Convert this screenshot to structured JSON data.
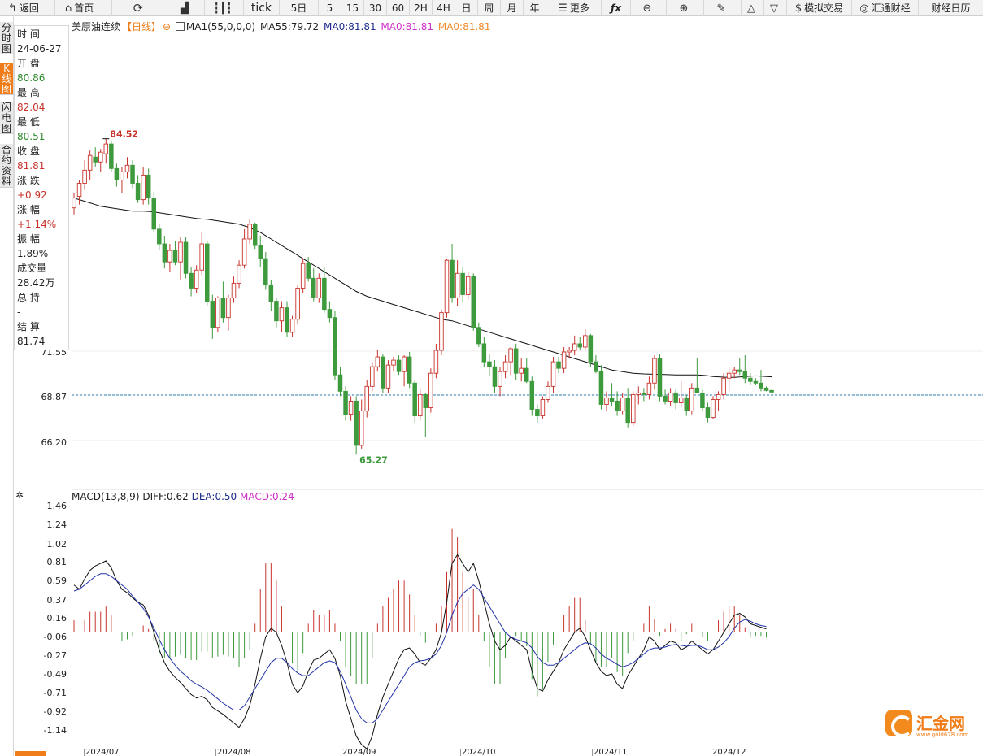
{
  "toolbar": {
    "back": "返回",
    "home": "首页",
    "tick": "tick",
    "periods": [
      "5日",
      "5",
      "15",
      "30",
      "60",
      "2H",
      "4H",
      "日",
      "周",
      "月",
      "年"
    ],
    "more": "更多",
    "sim_trade": "模拟交易",
    "huitong": "汇通财经",
    "calendar": "财经日历"
  },
  "side_tabs": [
    "分时图",
    "K线图",
    "闪电图",
    "合约资料"
  ],
  "info_panel": {
    "time_label": "时 间",
    "time_value": "24-06-27",
    "open_label": "开 盘",
    "open_value": "80.86",
    "high_label": "最 高",
    "high_value": "82.04",
    "low_label": "最 低",
    "low_value": "80.51",
    "close_label": "收 盘",
    "close_value": "81.81",
    "change_label": "涨 跌",
    "change_value": "+0.92",
    "pct_label": "涨 幅",
    "pct_value": "+1.14%",
    "amp_label": "振 幅",
    "amp_value": "1.89%",
    "vol_label": "成交量",
    "vol_value": "28.42万",
    "oi_label": "总 持",
    "oi_value": "-",
    "settle_label": "结 算",
    "settle_value": "81.74"
  },
  "legend": {
    "symbol": "美原油连续",
    "period": "【日线】",
    "ma1": "MA1(55,0,0,0)",
    "ma55": "MA55:79.72",
    "ma0a": "MA0:81.81",
    "ma0b": "MA0:81.81",
    "ma0c": "MA0:81.81"
  },
  "macd_legend": {
    "title": "MACD(13,8,9)",
    "diff": "DIFF:0.62",
    "dea": "DEA:0.50",
    "macd": "MACD:0.24"
  },
  "colors": {
    "up": "#c8322b",
    "down": "#3d9a3d",
    "ma": "#111111",
    "dea": "#2233aa",
    "accent": "#f07d1a",
    "last_line": "#2b7bb0"
  },
  "logo": {
    "text": "汇金网",
    "url": "www.gold678.com"
  },
  "chart_data": [
    {
      "type": "candlestick",
      "title": "美原油连续【日线】",
      "y_ticks": [
        "71.55",
        "68.87",
        "66.20"
      ],
      "last_price_label": "68.87",
      "high_marker": "84.52",
      "low_marker": "65.27",
      "x_labels": [
        "2024/07",
        "2024/08",
        "2024/09",
        "2024/10",
        "2024/11",
        "2024/12"
      ],
      "candles": [
        [
          80.3,
          81.2,
          79.9,
          80.9
        ],
        [
          81.0,
          82.0,
          80.5,
          81.8
        ],
        [
          81.8,
          83.2,
          81.4,
          82.6
        ],
        [
          82.6,
          83.8,
          82.0,
          83.5
        ],
        [
          83.4,
          84.0,
          82.8,
          83.1
        ],
        [
          83.1,
          83.9,
          82.5,
          83.7
        ],
        [
          83.6,
          84.52,
          83.0,
          84.2
        ],
        [
          84.2,
          84.4,
          82.5,
          82.7
        ],
        [
          82.7,
          83.0,
          81.6,
          82.0
        ],
        [
          82.0,
          82.8,
          81.2,
          82.5
        ],
        [
          82.5,
          83.4,
          82.1,
          82.9
        ],
        [
          82.9,
          83.2,
          81.5,
          81.8
        ],
        [
          81.8,
          82.3,
          80.6,
          80.8
        ],
        [
          80.8,
          82.8,
          80.5,
          82.3
        ],
        [
          82.3,
          82.7,
          80.5,
          80.9
        ],
        [
          80.9,
          81.3,
          78.8,
          79.0
        ],
        [
          79.0,
          79.3,
          77.7,
          78.1
        ],
        [
          78.1,
          78.6,
          76.6,
          77.0
        ],
        [
          77.0,
          78.1,
          76.4,
          77.7
        ],
        [
          77.7,
          78.3,
          76.8,
          77.0
        ],
        [
          77.0,
          78.5,
          75.9,
          78.2
        ],
        [
          78.2,
          78.5,
          76.0,
          76.3
        ],
        [
          76.3,
          76.7,
          74.9,
          75.4
        ],
        [
          75.4,
          76.8,
          75.1,
          76.5
        ],
        [
          76.5,
          78.8,
          76.2,
          78.1
        ],
        [
          78.1,
          78.3,
          74.3,
          74.6
        ],
        [
          74.6,
          75.0,
          72.3,
          73.0
        ],
        [
          73.0,
          74.9,
          72.7,
          74.8
        ],
        [
          74.8,
          75.8,
          73.3,
          73.6
        ],
        [
          73.6,
          75.0,
          72.8,
          74.8
        ],
        [
          74.8,
          76.1,
          74.5,
          75.7
        ],
        [
          75.7,
          77.1,
          75.4,
          76.8
        ],
        [
          76.8,
          79.0,
          76.6,
          78.4
        ],
        [
          78.4,
          79.6,
          78.1,
          79.3
        ],
        [
          79.3,
          79.4,
          77.8,
          78.0
        ],
        [
          78.0,
          78.6,
          76.7,
          77.2
        ],
        [
          77.2,
          77.6,
          75.3,
          75.6
        ],
        [
          75.6,
          75.9,
          74.0,
          74.6
        ],
        [
          74.6,
          74.8,
          73.0,
          73.4
        ],
        [
          73.4,
          74.6,
          72.7,
          74.2
        ],
        [
          74.2,
          74.6,
          72.4,
          72.7
        ],
        [
          72.7,
          73.7,
          72.4,
          73.5
        ],
        [
          73.5,
          75.6,
          73.2,
          75.4
        ],
        [
          75.4,
          77.2,
          75.1,
          76.9
        ],
        [
          76.9,
          77.3,
          75.8,
          76.0
        ],
        [
          76.0,
          76.6,
          74.6,
          74.8
        ],
        [
          74.8,
          76.3,
          74.5,
          76.0
        ],
        [
          76.0,
          76.7,
          73.9,
          74.1
        ],
        [
          74.1,
          74.6,
          73.3,
          73.6
        ],
        [
          73.6,
          74.0,
          69.8,
          70.1
        ],
        [
          70.1,
          70.6,
          68.8,
          69.1
        ],
        [
          69.1,
          69.4,
          67.3,
          67.7
        ],
        [
          67.7,
          68.8,
          67.3,
          68.5
        ],
        [
          68.5,
          68.8,
          65.27,
          65.8
        ],
        [
          65.8,
          68.6,
          65.6,
          67.9
        ],
        [
          67.9,
          69.8,
          67.5,
          69.4
        ],
        [
          69.4,
          70.9,
          69.1,
          70.6
        ],
        [
          70.6,
          71.6,
          70.3,
          71.2
        ],
        [
          71.2,
          71.4,
          69.0,
          69.3
        ],
        [
          69.3,
          71.0,
          69.0,
          70.7
        ],
        [
          70.7,
          71.2,
          70.3,
          71.0
        ],
        [
          71.0,
          71.3,
          70.1,
          70.3
        ],
        [
          70.3,
          71.3,
          69.4,
          71.2
        ],
        [
          71.2,
          71.5,
          69.3,
          69.6
        ],
        [
          69.6,
          69.8,
          67.2,
          67.6
        ],
        [
          67.6,
          69.2,
          67.3,
          68.9
        ],
        [
          68.9,
          69.0,
          66.3,
          68.1
        ],
        [
          68.1,
          70.5,
          67.8,
          70.2
        ],
        [
          70.2,
          72.0,
          69.9,
          71.6
        ],
        [
          71.6,
          74.1,
          71.3,
          73.9
        ],
        [
          73.9,
          77.2,
          73.6,
          77.1
        ],
        [
          77.1,
          78.1,
          74.5,
          74.8
        ],
        [
          74.8,
          77.1,
          74.3,
          76.3
        ],
        [
          76.3,
          76.7,
          74.5,
          75.0
        ],
        [
          75.0,
          76.4,
          74.7,
          76.1
        ],
        [
          76.1,
          76.3,
          72.8,
          73.0
        ],
        [
          73.0,
          73.3,
          71.8,
          72.0
        ],
        [
          72.0,
          72.4,
          70.6,
          70.9
        ],
        [
          70.9,
          71.4,
          70.0,
          70.6
        ],
        [
          70.6,
          71.0,
          69.0,
          69.4
        ],
        [
          69.4,
          70.6,
          68.8,
          70.3
        ],
        [
          70.3,
          71.3,
          69.9,
          70.9
        ],
        [
          70.9,
          71.8,
          70.1,
          71.7
        ],
        [
          71.7,
          72.0,
          69.8,
          70.2
        ],
        [
          70.2,
          71.1,
          69.7,
          70.5
        ],
        [
          70.5,
          71.1,
          69.6,
          69.7
        ],
        [
          69.7,
          70.0,
          67.6,
          68.0
        ],
        [
          68.0,
          68.3,
          67.2,
          67.6
        ],
        [
          67.6,
          68.8,
          67.4,
          68.6
        ],
        [
          68.6,
          69.7,
          68.4,
          69.4
        ],
        [
          69.4,
          71.2,
          69.0,
          70.9
        ],
        [
          70.9,
          71.2,
          70.2,
          70.5
        ],
        [
          70.5,
          71.8,
          70.2,
          71.5
        ],
        [
          71.5,
          71.8,
          71.1,
          71.6
        ],
        [
          71.6,
          72.5,
          71.3,
          72.0
        ],
        [
          72.0,
          72.4,
          71.6,
          71.8
        ],
        [
          71.8,
          72.9,
          71.6,
          72.5
        ],
        [
          72.5,
          72.6,
          70.6,
          70.9
        ],
        [
          70.9,
          71.3,
          70.2,
          70.3
        ],
        [
          70.3,
          70.7,
          68.0,
          68.3
        ],
        [
          68.3,
          69.1,
          67.9,
          68.7
        ],
        [
          68.7,
          69.6,
          68.2,
          68.5
        ],
        [
          68.5,
          69.1,
          67.6,
          67.9
        ],
        [
          67.9,
          69.0,
          67.7,
          68.7
        ],
        [
          68.7,
          69.3,
          66.9,
          67.2
        ],
        [
          67.2,
          69.1,
          67.0,
          68.9
        ],
        [
          68.9,
          69.4,
          68.3,
          69.0
        ],
        [
          69.0,
          69.3,
          68.5,
          68.9
        ],
        [
          68.9,
          70.0,
          68.6,
          69.6
        ],
        [
          69.6,
          71.3,
          69.2,
          71.1
        ],
        [
          71.1,
          71.4,
          68.5,
          68.8
        ],
        [
          68.8,
          69.2,
          68.3,
          68.5
        ],
        [
          68.5,
          69.3,
          68.2,
          69.0
        ],
        [
          69.0,
          69.2,
          68.0,
          68.4
        ],
        [
          68.4,
          69.7,
          68.1,
          68.7
        ],
        [
          68.7,
          68.9,
          67.6,
          67.9
        ],
        [
          67.9,
          69.6,
          67.7,
          69.3
        ],
        [
          69.3,
          71.1,
          69.1,
          69.0
        ],
        [
          69.0,
          69.2,
          67.9,
          68.1
        ],
        [
          68.1,
          68.4,
          67.2,
          67.5
        ],
        [
          67.5,
          68.8,
          67.4,
          68.6
        ],
        [
          68.6,
          69.1,
          67.9,
          68.9
        ],
        [
          68.9,
          70.2,
          68.6,
          69.9
        ],
        [
          69.9,
          70.6,
          69.1,
          70.2
        ],
        [
          70.2,
          70.6,
          69.9,
          70.4
        ],
        [
          70.4,
          71.1,
          70.1,
          70.3
        ],
        [
          70.3,
          71.3,
          69.6,
          69.9
        ],
        [
          69.9,
          70.2,
          69.5,
          69.7
        ],
        [
          69.7,
          69.9,
          69.5,
          69.6
        ],
        [
          69.6,
          70.4,
          69.1,
          69.3
        ],
        [
          69.3,
          69.4,
          69.1,
          69.15
        ],
        [
          69.15,
          69.2,
          69.0,
          69.05
        ]
      ],
      "ma55": [
        80.9,
        80.8,
        80.7,
        80.6,
        80.5,
        80.4,
        80.35,
        80.3,
        80.25,
        80.2,
        80.15,
        80.1,
        80.1,
        80.1,
        80.08,
        80.05,
        80.0,
        79.95,
        79.9,
        79.85,
        79.8,
        79.75,
        79.7,
        79.65,
        79.62,
        79.6,
        79.55,
        79.5,
        79.45,
        79.4,
        79.35,
        79.3,
        79.2,
        79.1,
        78.95,
        78.8,
        78.6,
        78.4,
        78.2,
        78.0,
        77.8,
        77.6,
        77.4,
        77.2,
        77.0,
        76.8,
        76.6,
        76.4,
        76.2,
        76.0,
        75.8,
        75.6,
        75.4,
        75.2,
        75.05,
        74.9,
        74.8,
        74.7,
        74.6,
        74.5,
        74.4,
        74.3,
        74.2,
        74.1,
        74.0,
        73.9,
        73.8,
        73.7,
        73.6,
        73.5,
        73.45,
        73.4,
        73.3,
        73.2,
        73.1,
        73.0,
        72.9,
        72.8,
        72.7,
        72.6,
        72.5,
        72.4,
        72.3,
        72.2,
        72.1,
        72.0,
        71.9,
        71.8,
        71.7,
        71.6,
        71.5,
        71.4,
        71.3,
        71.2,
        71.1,
        71.0,
        70.9,
        70.8,
        70.7,
        70.6,
        70.5,
        70.4,
        70.35,
        70.3,
        70.25,
        70.2,
        70.18,
        70.16,
        70.15,
        70.14,
        70.13,
        70.12,
        70.11,
        70.1,
        70.1,
        70.1,
        70.1,
        70.1,
        70.08,
        70.05,
        70.0,
        69.98,
        69.96,
        69.95,
        69.95,
        69.97,
        70.0,
        70.02,
        70.04,
        70.02,
        70.0,
        69.98
      ],
      "macd_y_ticks": [
        "1.46",
        "1.24",
        "1.02",
        "0.81",
        "0.59",
        "0.37",
        "0.16",
        "-0.06",
        "-0.27",
        "-0.49",
        "-0.71",
        "-0.92",
        "-1.14"
      ],
      "diff": [
        0.55,
        0.5,
        0.62,
        0.72,
        0.77,
        0.8,
        0.83,
        0.75,
        0.6,
        0.5,
        0.46,
        0.4,
        0.35,
        0.32,
        0.2,
        0.0,
        -0.2,
        -0.35,
        -0.45,
        -0.52,
        -0.58,
        -0.65,
        -0.72,
        -0.76,
        -0.74,
        -0.78,
        -0.87,
        -0.91,
        -0.95,
        -1.0,
        -1.05,
        -1.1,
        -1.0,
        -0.85,
        -0.6,
        -0.3,
        -0.05,
        0.05,
        0.0,
        -0.15,
        -0.35,
        -0.6,
        -0.7,
        -0.62,
        -0.45,
        -0.32,
        -0.3,
        -0.25,
        -0.2,
        -0.3,
        -0.5,
        -0.8,
        -1.0,
        -1.2,
        -1.3,
        -1.35,
        -1.2,
        -0.95,
        -0.75,
        -0.6,
        -0.45,
        -0.3,
        -0.2,
        -0.18,
        -0.25,
        -0.35,
        -0.38,
        -0.3,
        -0.2,
        0.0,
        0.35,
        0.8,
        0.9,
        0.8,
        0.7,
        0.8,
        0.6,
        0.35,
        0.1,
        -0.1,
        -0.2,
        -0.15,
        -0.05,
        -0.1,
        -0.15,
        -0.2,
        -0.45,
        -0.65,
        -0.68,
        -0.55,
        -0.45,
        -0.35,
        -0.2,
        -0.1,
        0.0,
        0.05,
        -0.05,
        -0.2,
        -0.35,
        -0.45,
        -0.5,
        -0.48,
        -0.6,
        -0.65,
        -0.5,
        -0.4,
        -0.3,
        -0.2,
        -0.05,
        -0.1,
        -0.2,
        -0.15,
        -0.1,
        -0.12,
        -0.2,
        -0.17,
        -0.1,
        -0.15,
        -0.2,
        -0.25,
        -0.2,
        -0.1,
        0.0,
        0.1,
        0.2,
        0.22,
        0.18,
        0.1,
        0.08,
        0.06,
        0.04
      ],
      "dea": [
        0.48,
        0.5,
        0.55,
        0.6,
        0.65,
        0.68,
        0.68,
        0.65,
        0.6,
        0.55,
        0.5,
        0.42,
        0.35,
        0.28,
        0.18,
        0.05,
        -0.08,
        -0.2,
        -0.3,
        -0.38,
        -0.45,
        -0.5,
        -0.56,
        -0.6,
        -0.63,
        -0.67,
        -0.72,
        -0.77,
        -0.82,
        -0.86,
        -0.9,
        -0.9,
        -0.85,
        -0.75,
        -0.65,
        -0.55,
        -0.45,
        -0.35,
        -0.3,
        -0.3,
        -0.35,
        -0.42,
        -0.47,
        -0.5,
        -0.5,
        -0.45,
        -0.4,
        -0.35,
        -0.33,
        -0.35,
        -0.45,
        -0.6,
        -0.75,
        -0.9,
        -1.0,
        -1.05,
        -1.05,
        -1.0,
        -0.9,
        -0.8,
        -0.7,
        -0.6,
        -0.5,
        -0.4,
        -0.35,
        -0.33,
        -0.32,
        -0.3,
        -0.25,
        -0.15,
        0.0,
        0.2,
        0.35,
        0.45,
        0.5,
        0.55,
        0.5,
        0.4,
        0.3,
        0.2,
        0.1,
        0.0,
        -0.05,
        -0.08,
        -0.1,
        -0.12,
        -0.18,
        -0.28,
        -0.35,
        -0.38,
        -0.38,
        -0.35,
        -0.3,
        -0.25,
        -0.2,
        -0.15,
        -0.12,
        -0.13,
        -0.18,
        -0.25,
        -0.3,
        -0.33,
        -0.37,
        -0.4,
        -0.38,
        -0.35,
        -0.3,
        -0.25,
        -0.2,
        -0.18,
        -0.18,
        -0.17,
        -0.15,
        -0.14,
        -0.15,
        -0.16,
        -0.15,
        -0.15,
        -0.17,
        -0.2,
        -0.2,
        -0.17,
        -0.12,
        -0.05,
        0.05,
        0.12,
        0.15,
        0.13,
        0.1,
        0.08,
        0.07
      ]
    }
  ]
}
